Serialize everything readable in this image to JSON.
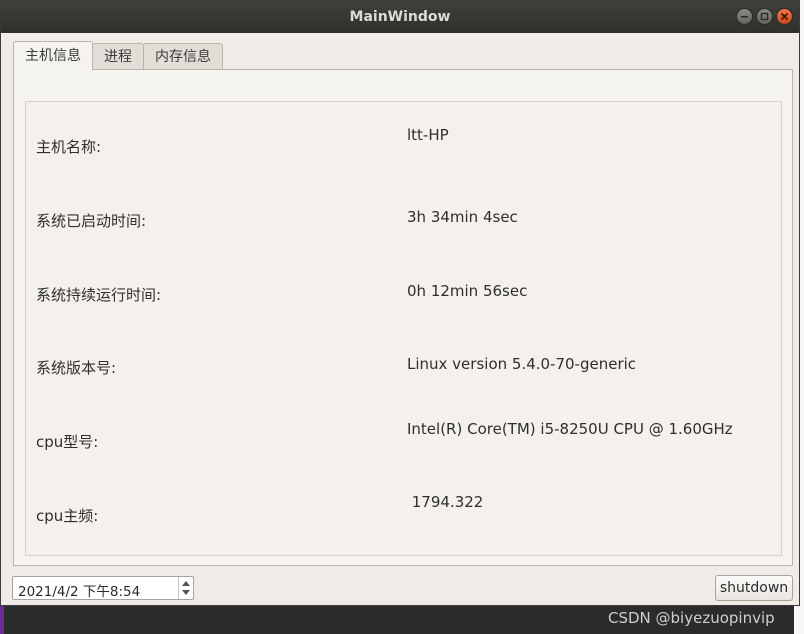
{
  "window": {
    "title": "MainWindow"
  },
  "tabs": [
    {
      "label": "主机信息",
      "active": true
    },
    {
      "label": "进程",
      "active": false
    },
    {
      "label": "内存信息",
      "active": false
    }
  ],
  "host_info": [
    {
      "label": "主机名称:",
      "value": "ltt-HP"
    },
    {
      "label": "系统已启动时间:",
      "value": "3h 34min 4sec"
    },
    {
      "label": "系统持续运行时间:",
      "value": "0h 12min 56sec"
    },
    {
      "label": "系统版本号:",
      "value": "Linux version 5.4.0-70-generic"
    },
    {
      "label": "cpu型号:",
      "value": "Intel(R) Core(TM) i5-8250U CPU @ 1.60GHz"
    },
    {
      "label": "cpu主频:",
      "value": " 1794.322"
    }
  ],
  "footer": {
    "datetime": "2021/4/2 下午8:54",
    "shutdown_label": "shutdown"
  },
  "watermark": "CSDN @biyezuopinvip"
}
